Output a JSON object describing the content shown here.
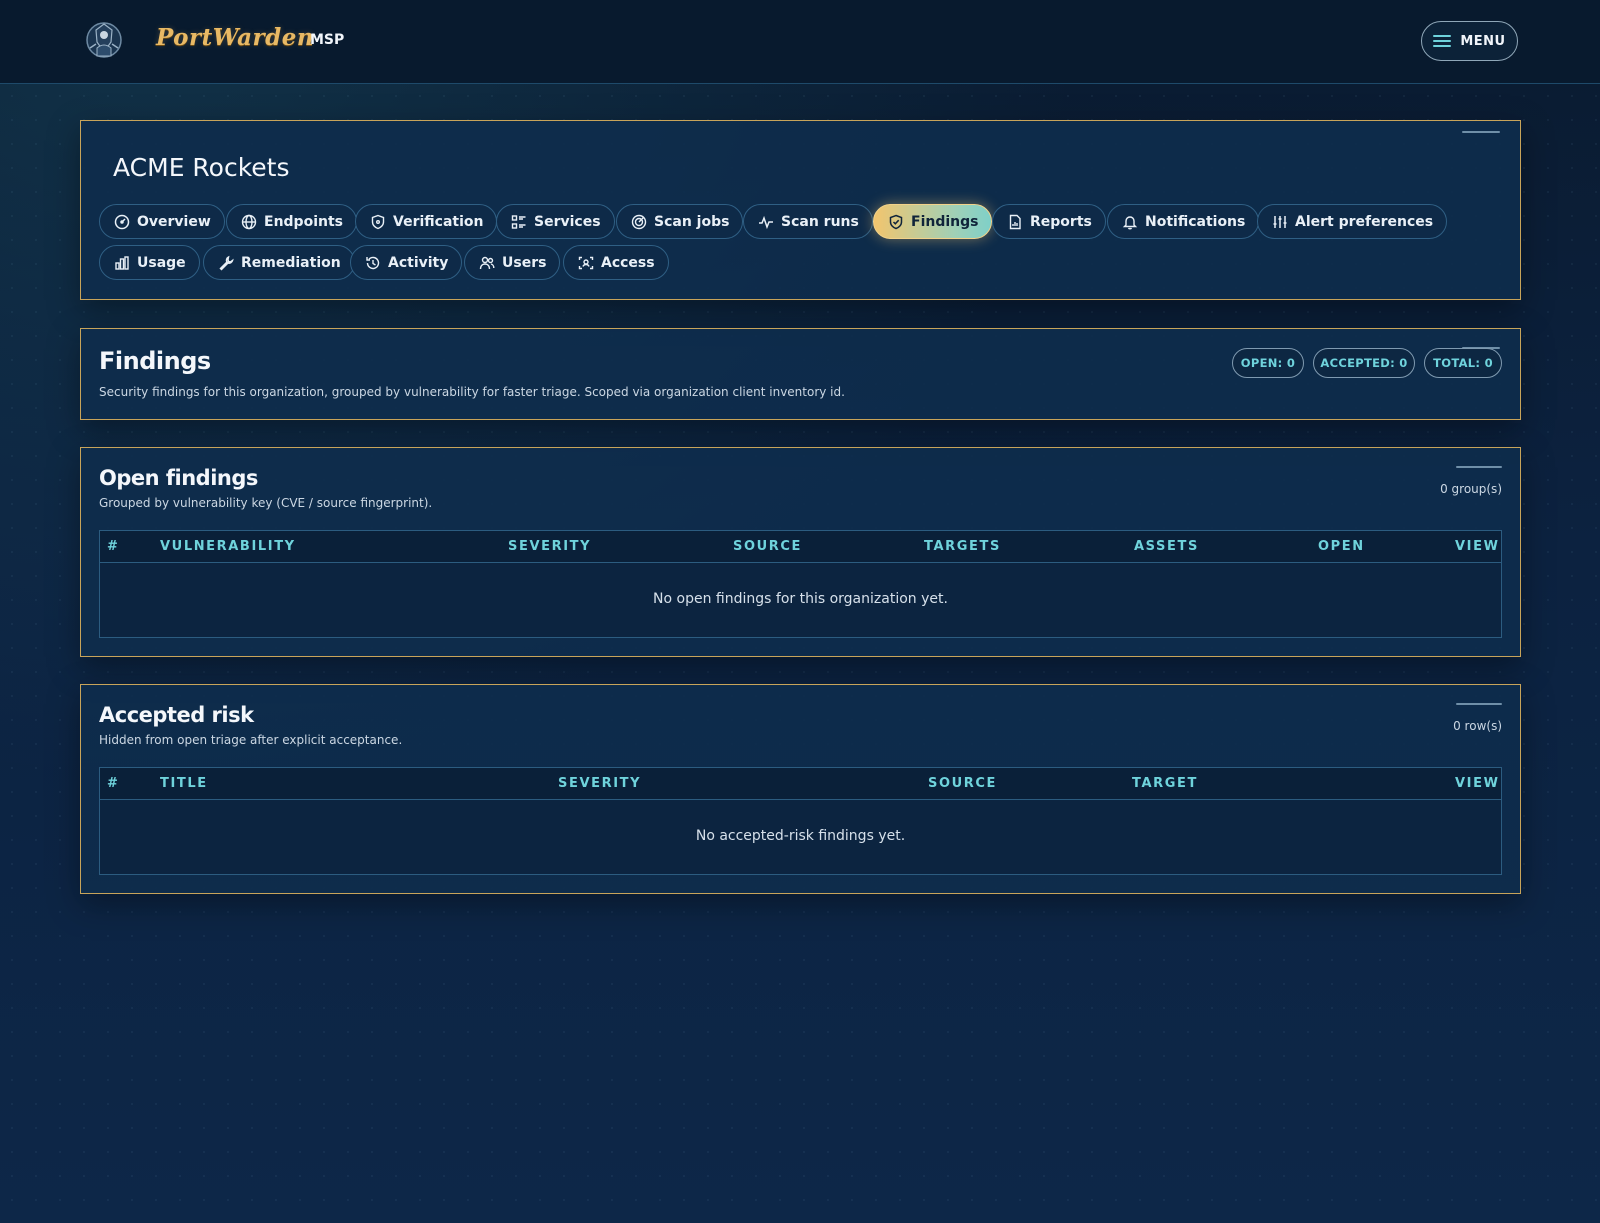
{
  "header": {
    "brand": "PortWarden",
    "brand_sub": "MSP",
    "menu_label": "MENU"
  },
  "org": {
    "title": "ACME Rockets",
    "tabs": [
      {
        "label": "Overview",
        "icon": "gauge-icon"
      },
      {
        "label": "Endpoints",
        "icon": "globe-icon"
      },
      {
        "label": "Verification",
        "icon": "shield-icon"
      },
      {
        "label": "Services",
        "icon": "list-icon"
      },
      {
        "label": "Scan jobs",
        "icon": "radar-icon"
      },
      {
        "label": "Scan runs",
        "icon": "pulse-icon"
      },
      {
        "label": "Findings",
        "icon": "shield-check-icon",
        "active": true
      },
      {
        "label": "Reports",
        "icon": "report-icon"
      },
      {
        "label": "Notifications",
        "icon": "bell-icon"
      },
      {
        "label": "Alert preferences",
        "icon": "sliders-icon"
      },
      {
        "label": "Usage",
        "icon": "bar-chart-icon"
      },
      {
        "label": "Remediation",
        "icon": "wrench-icon"
      },
      {
        "label": "Activity",
        "icon": "history-icon"
      },
      {
        "label": "Users",
        "icon": "users-icon"
      },
      {
        "label": "Access",
        "icon": "scan-face-icon"
      }
    ]
  },
  "findings": {
    "title": "Findings",
    "description": "Security findings for this organization, grouped by vulnerability for faster triage. Scoped via organization client inventory id.",
    "pills": {
      "open": "OPEN: 0",
      "accepted": "ACCEPTED: 0",
      "total": "TOTAL: 0"
    }
  },
  "open_findings": {
    "title": "Open findings",
    "description": "Grouped by vulnerability key (CVE / source fingerprint).",
    "count": "0 group(s)",
    "columns": [
      "#",
      "VULNERABILITY",
      "SEVERITY",
      "SOURCE",
      "TARGETS",
      "ASSETS",
      "OPEN",
      "VIEW"
    ],
    "empty": "No open findings for this organization yet."
  },
  "accepted_risk": {
    "title": "Accepted risk",
    "description": "Hidden from open triage after explicit acceptance.",
    "count": "0 row(s)",
    "columns": [
      "#",
      "TITLE",
      "SEVERITY",
      "SOURCE",
      "TARGET",
      "VIEW"
    ],
    "empty": "No accepted-risk findings yet."
  },
  "colors": {
    "accent_gold": "#c8a45a",
    "accent_cyan": "#6fd3dc",
    "background": "#0c2240"
  }
}
